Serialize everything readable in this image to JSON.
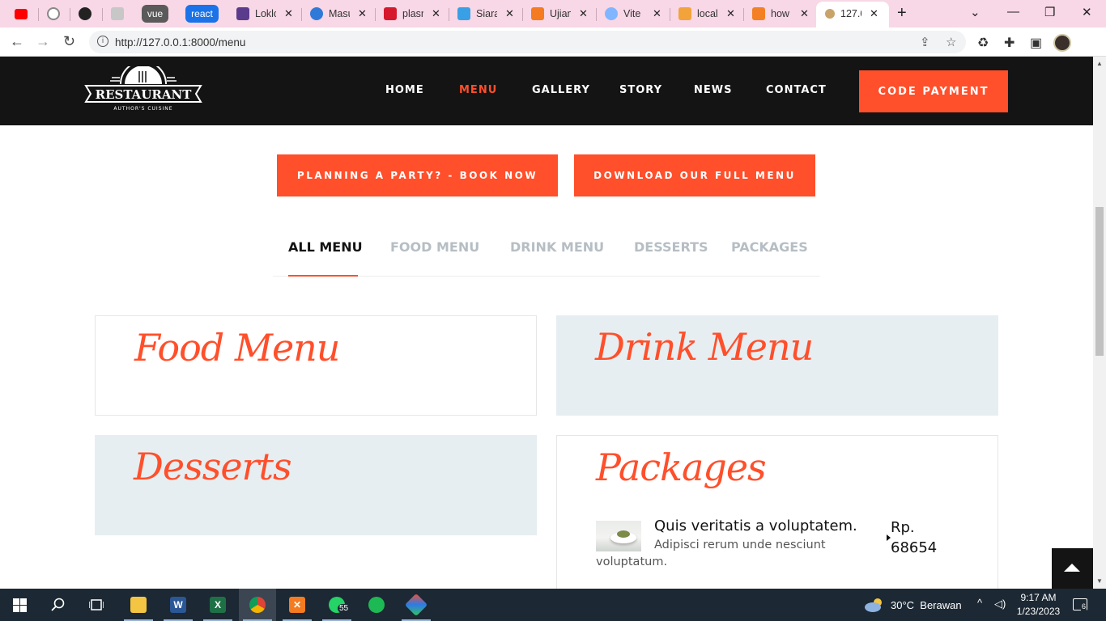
{
  "browser": {
    "tabs": [
      {
        "label": ""
      },
      {
        "label": ""
      },
      {
        "label": ""
      },
      {
        "label": ""
      },
      {
        "label": "vue"
      },
      {
        "label": "react"
      },
      {
        "label": "Loklo"
      },
      {
        "label": "Masu"
      },
      {
        "label": "plasn"
      },
      {
        "label": "Siara"
      },
      {
        "label": "Ujian"
      },
      {
        "label": "Vite"
      },
      {
        "label": "local"
      },
      {
        "label": "how"
      },
      {
        "label": "127.0"
      }
    ],
    "url": "http://127.0.0.1:8000/menu",
    "colors": {
      "tabstrip": "#f8d7e6",
      "vue_pill": "#5a5a5a",
      "react_pill": "#1a73e8"
    }
  },
  "site": {
    "logo_text": "RESTAURANT",
    "logo_subtext": "AUTHOR'S CUISINE",
    "nav": [
      {
        "label": "HOME",
        "active": false
      },
      {
        "label": "MENU",
        "active": true
      },
      {
        "label": "GALLERY",
        "active": false
      },
      {
        "label": "STORY",
        "active": false
      },
      {
        "label": "NEWS",
        "active": false
      },
      {
        "label": "CONTACT",
        "active": false
      }
    ],
    "cta_label": "CODE PAYMENT",
    "accent": "#ff4f2b",
    "header_bg": "#141414"
  },
  "actions": {
    "book_label": "PLANNING A PARTY? - BOOK NOW",
    "download_label": "DOWNLOAD OUR FULL MENU"
  },
  "filter_tabs": [
    {
      "label": "ALL MENU",
      "active": true
    },
    {
      "label": "FOOD MENU",
      "active": false
    },
    {
      "label": "DRINK MENU",
      "active": false
    },
    {
      "label": "DESSERTS",
      "active": false
    },
    {
      "label": "PACKAGES",
      "active": false
    }
  ],
  "sections": {
    "food": {
      "title": "Food Menu"
    },
    "drink": {
      "title": "Drink Menu"
    },
    "desserts": {
      "title": "Desserts"
    },
    "packages": {
      "title": "Packages",
      "items": [
        {
          "name": "Quis veritatis a voluptatem.",
          "description": "Adipisci rerum unde nesciunt voluptatum.",
          "price": "Rp. 68654"
        }
      ]
    }
  },
  "taskbar": {
    "whatsapp_badge": "55",
    "weather": "30°C  Berawan",
    "time": "9:17 AM",
    "date": "1/23/2023",
    "notifications": "6"
  }
}
